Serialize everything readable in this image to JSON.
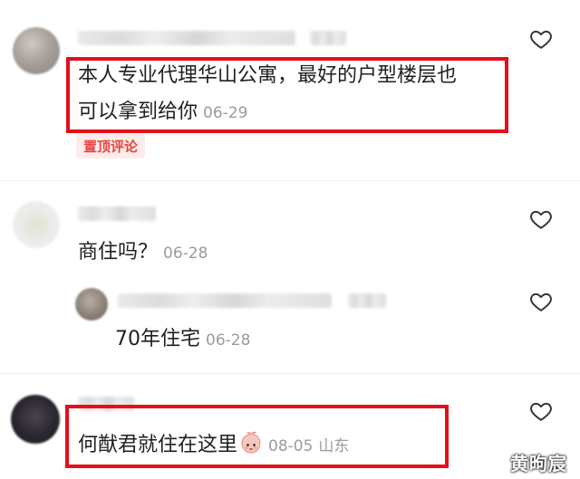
{
  "comments": [
    {
      "text_line1": "本人专业代理华山公寓，最好的户型楼层也",
      "text_line2": "可以拿到给你",
      "date": "06-29",
      "tag": "置顶评论"
    },
    {
      "text": "商住吗？",
      "date": "06-28"
    },
    {
      "text": "70年住宅",
      "date": "06-28"
    },
    {
      "text": "何猷君就住在这里",
      "emoji": "peach-face-emoji",
      "date": "08-05",
      "location": "山东"
    }
  ],
  "icons": {
    "like": "heart-outline-icon"
  },
  "colors": {
    "highlight_border": "#e4101a",
    "pin_tag_text": "#e7443f",
    "date_text": "#9b9b9b"
  },
  "watermark": "黄昫宸"
}
